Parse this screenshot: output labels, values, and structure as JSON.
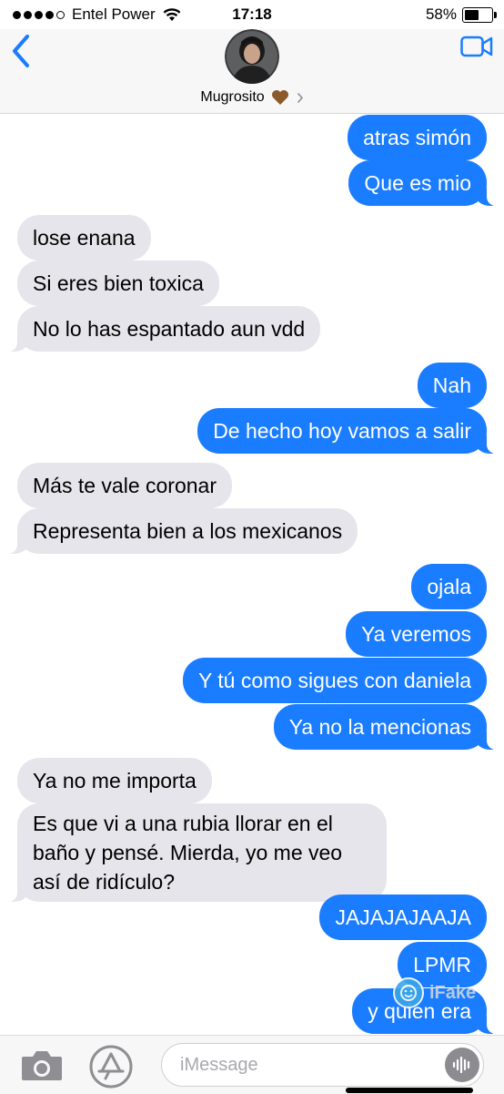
{
  "status_bar": {
    "carrier": "Entel Power",
    "time": "17:18",
    "battery_percent": "58%",
    "battery_level": 0.58,
    "signal_bars": 4
  },
  "header": {
    "contact_name": "Mugrosito",
    "contact_emoji": "heart-brown",
    "back_icon": "chevron-left-icon",
    "video_icon": "video-camera-icon"
  },
  "messages": [
    {
      "side": "sent",
      "text": "atras simón"
    },
    {
      "side": "sent",
      "text": "Que es mio"
    },
    {
      "side": "received",
      "text": "lose enana"
    },
    {
      "side": "received",
      "text": "Si eres bien toxica"
    },
    {
      "side": "received",
      "text": "No lo has espantado aun vdd"
    },
    {
      "side": "sent",
      "text": "Nah"
    },
    {
      "side": "sent",
      "text": "De hecho hoy vamos a salir"
    },
    {
      "side": "received",
      "text": "Más te vale coronar"
    },
    {
      "side": "received",
      "text": "Representa bien a los mexicanos"
    },
    {
      "side": "sent",
      "text": "ojala"
    },
    {
      "side": "sent",
      "text": "Ya veremos"
    },
    {
      "side": "sent",
      "text": "Y tú como sigues con daniela"
    },
    {
      "side": "sent",
      "text": "Ya no la mencionas"
    },
    {
      "side": "received",
      "text": "Ya no me importa"
    },
    {
      "side": "received",
      "text": "Es que vi a una rubia llorar en el baño y pensé. Mierda, yo me veo así de ridículo?"
    },
    {
      "side": "sent",
      "text": "JAJAJAJAAJA"
    },
    {
      "side": "sent",
      "text": "LPMR"
    },
    {
      "side": "sent",
      "text": "y quien era"
    }
  ],
  "watermark": {
    "text": "iFake"
  },
  "input_bar": {
    "placeholder": "iMessage",
    "camera_icon": "camera-icon",
    "apps_icon": "app-store-icon",
    "audio_icon": "audio-wave-icon"
  },
  "colors": {
    "sent_bubble": "#1a7cff",
    "received_bubble": "#e6e5eb",
    "accent": "#1a7cff"
  }
}
